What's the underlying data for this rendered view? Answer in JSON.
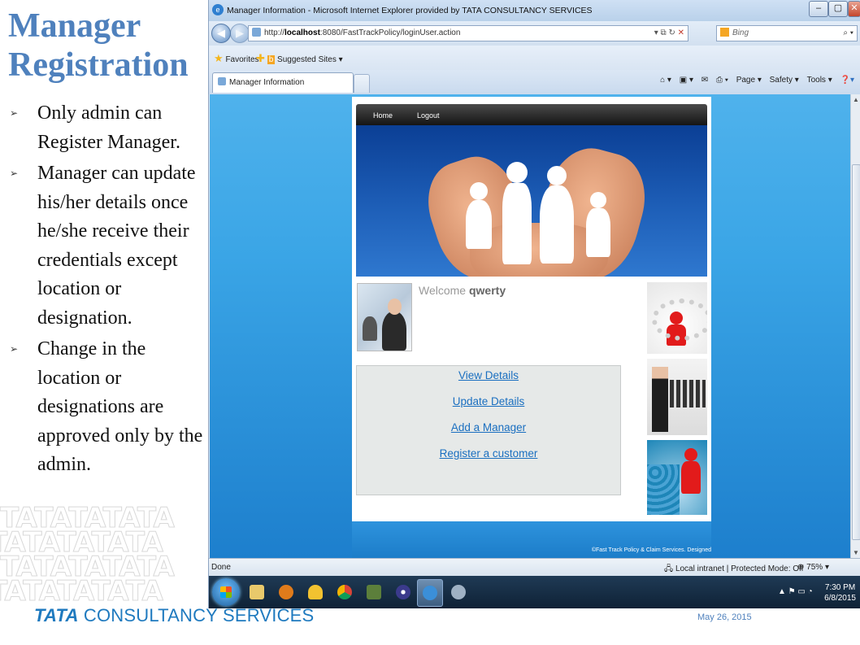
{
  "slide": {
    "title_line1": "Manager",
    "title_line2": "Registration",
    "bullets": [
      "Only admin can Register Manager.",
      "Manager can update his/her details once he/she receive their credentials except location or designation.",
      "Change in the location or designations are approved only by the admin."
    ],
    "footer_logo_tata": "TATA",
    "footer_logo_rest": "CONSULTANCY SERVICES",
    "date": "May 26, 2015",
    "pattern_text": "TATATATATA"
  },
  "browser": {
    "window_title": "Manager Information - Microsoft Internet Explorer provided by TATA CONSULTANCY SERVICES",
    "url_prefix": "http://",
    "url_host": "localhost",
    "url_rest": ":8080/FastTrackPolicy/loginUser.action",
    "search_placeholder": "Bing",
    "favorites_label": "Favorites",
    "suggested_sites_label": "Suggested Sites ▾",
    "tab_label": "Manager Information",
    "cmd_page": "Page ▾",
    "cmd_safety": "Safety ▾",
    "cmd_tools": "Tools ▾",
    "status_done": "Done",
    "status_zone": "Local intranet | Protected Mode: Off",
    "zoom": "75%",
    "clock_time": "7:30 PM",
    "clock_date": "6/8/2015"
  },
  "webpage": {
    "nav_home": "Home",
    "nav_logout": "Logout",
    "welcome_prefix": "Welcome",
    "welcome_user": "qwerty",
    "links": [
      "View Details",
      "Update Details",
      "Add a Manager",
      "Register a customer"
    ],
    "footer_copy": "©Fast Track Policy & Claim Services. Designed"
  },
  "colors": {
    "slide_title": "#4f81bd",
    "link": "#1a6fc0",
    "tcs_blue": "#1f7abf"
  }
}
